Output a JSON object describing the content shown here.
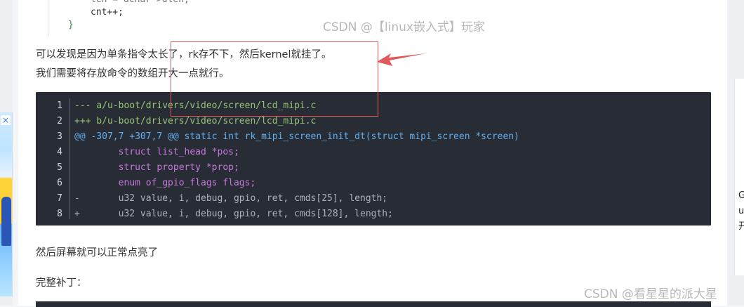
{
  "top_code": {
    "line1": "len = dchar->dlen;",
    "line2": "cnt++;",
    "line3": "}"
  },
  "watermarks": {
    "top": "CSDN @【linux嵌入式】玩家",
    "bottom": "CSDN @看星星的派大星"
  },
  "paragraphs": {
    "p1": "可以发现是因为单条指令太长了，rk存不下，然后kernel就挂了。",
    "p2": "我们需要将存放命令的数组开大一点就行。",
    "p3": "然后屏幕就可以正常点亮了",
    "p4": "完整补丁："
  },
  "code_block": {
    "line_numbers": [
      "1",
      "2",
      "3",
      "4",
      "5",
      "6",
      "7",
      "8"
    ],
    "lines": [
      "--- a/u-boot/drivers/video/screen/lcd_mipi.c",
      "+++ b/u-boot/drivers/video/screen/lcd_mipi.c",
      "@@ -307,7 +307,7 @@ static int rk_mipi_screen_init_dt(struct mipi_screen *screen)",
      "        struct list_head *pos;",
      "        struct property *prop;",
      "        enum of_gpio_flags flags;",
      "-       u32 value, i, debug, gpio, ret, cmds[25], length;",
      "+       u32 value, i, debug, gpio, ret, cmds[128], length;"
    ]
  },
  "right_sidebar_chars": [
    "G",
    "u",
    "开"
  ],
  "ad": {
    "close_glyph": "×"
  },
  "colors": {
    "code_bg": "#282c34",
    "annotation_red": "#e05a5a",
    "page_bg": "#f4f5f7"
  }
}
